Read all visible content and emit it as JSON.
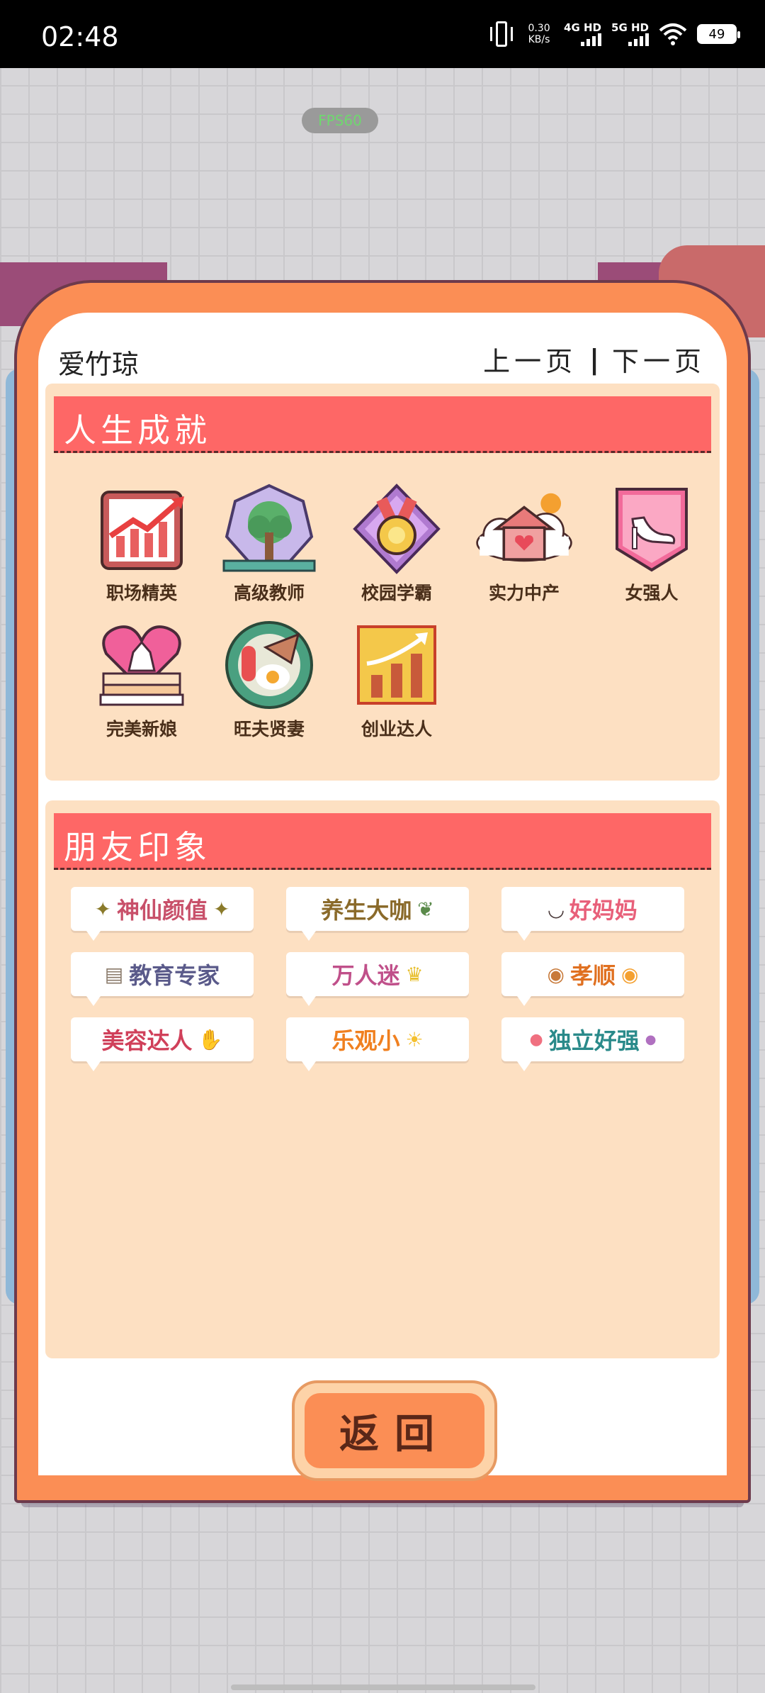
{
  "status_bar": {
    "time": "02:48",
    "net_speed": "0.30\nKB/s",
    "sim1": "4G HD",
    "sim2": "5G HD",
    "battery": "49"
  },
  "background": {
    "fps": "FPS60"
  },
  "dialog": {
    "player_name": "爱竹琼",
    "prev_page": "上一页",
    "next_page": "下一页",
    "separator": "|",
    "achievements": {
      "title": "人生成就",
      "items": [
        {
          "label": "职场精英",
          "icon": "career-chart-icon"
        },
        {
          "label": "高级教师",
          "icon": "tree-book-icon"
        },
        {
          "label": "校园学霸",
          "icon": "medal-icon"
        },
        {
          "label": "实力中产",
          "icon": "house-cloud-icon"
        },
        {
          "label": "女强人",
          "icon": "high-heel-icon"
        },
        {
          "label": "完美新娘",
          "icon": "wedding-cake-icon"
        },
        {
          "label": "旺夫贤妻",
          "icon": "dinner-plate-icon"
        },
        {
          "label": "创业达人",
          "icon": "growth-bars-icon"
        }
      ]
    },
    "friends": {
      "title": "朋友印象",
      "tags": [
        {
          "text": "神仙颜值",
          "color": "#c8506a",
          "deco": "✦"
        },
        {
          "text": "养生大咖",
          "color": "#8a6a2a",
          "deco": "❦"
        },
        {
          "text": "好妈妈",
          "color": "#e8607a",
          "deco": "◡"
        },
        {
          "text": "教育专家",
          "color": "#5a5a8a",
          "deco": "▤"
        },
        {
          "text": "万人迷",
          "color": "#c0508a",
          "deco": "♛"
        },
        {
          "text": "孝顺",
          "color": "#e07020",
          "deco": "◉"
        },
        {
          "text": "美容达人",
          "color": "#d0405a",
          "deco": "✋"
        },
        {
          "text": "乐观小",
          "color": "#f08020",
          "deco": "☀"
        },
        {
          "text": "独立好强",
          "color": "#2a8a8a",
          "deco": "●"
        }
      ]
    },
    "return_label": "返回"
  }
}
